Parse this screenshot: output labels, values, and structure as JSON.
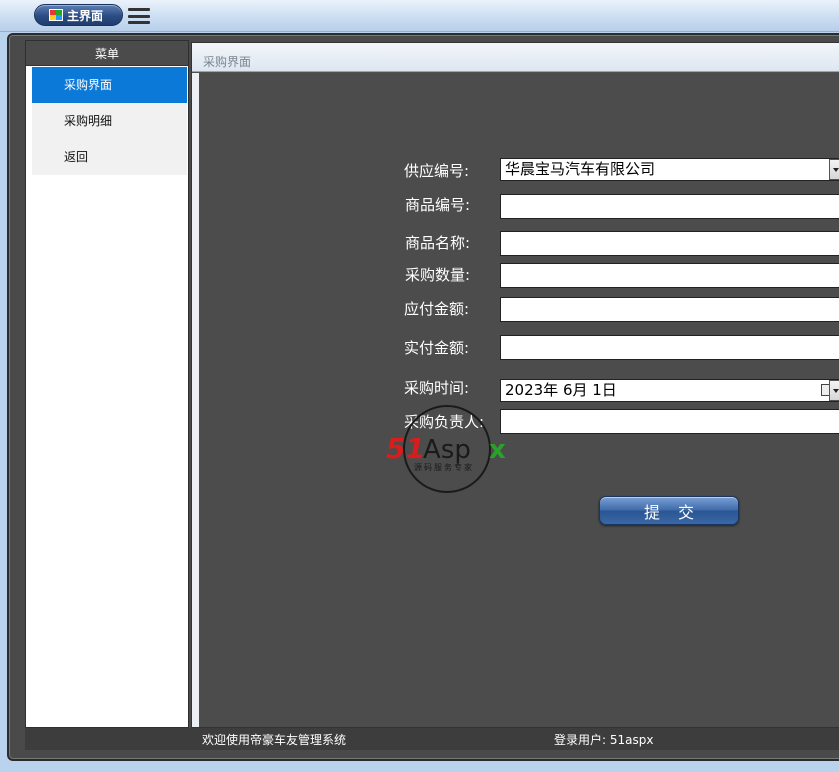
{
  "topbar": {
    "main_button_label": "主界面"
  },
  "sidebar": {
    "title": "菜单",
    "items": [
      {
        "label": "采购界面",
        "active": true
      },
      {
        "label": "采购明细",
        "active": false
      },
      {
        "label": "返回",
        "active": false
      }
    ]
  },
  "content": {
    "title": "采购界面",
    "form": {
      "supplier_label": "供应编号:",
      "supplier_value": "华晨宝马汽车有限公司",
      "product_id_label": "商品编号:",
      "product_id_value": "",
      "product_name_label": "商品名称:",
      "product_name_value": "",
      "quantity_label": "采购数量:",
      "quantity_value": "",
      "payable_label": "应付金额:",
      "payable_value": "",
      "paid_label": "实付金额:",
      "paid_value": "",
      "date_label": "采购时间:",
      "date_value": "2023年  6月  1日",
      "owner_label": "采购负责人:",
      "owner_value": "",
      "submit_label": "提交"
    },
    "watermark": {
      "brand": "51Aspx",
      "slogan": "源码服务专家"
    }
  },
  "statusbar": {
    "welcome": "欢迎使用帝豪车友管理系统",
    "user": "登录用户: 51aspx"
  },
  "colors": {
    "accent": "#0b79d8",
    "panel": "#4c4c4c",
    "topbar": "#c9dcf1"
  }
}
